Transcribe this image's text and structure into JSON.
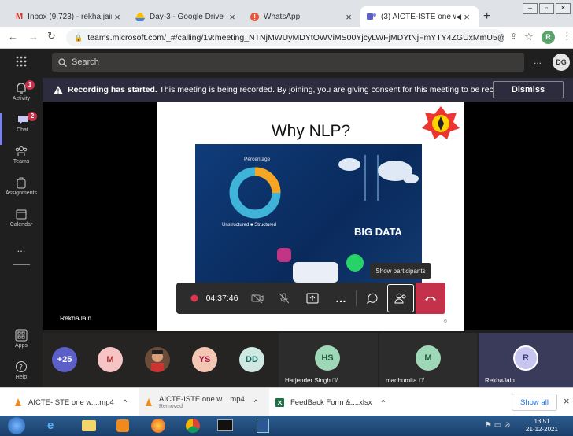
{
  "tabs": [
    {
      "title": "Inbox (9,723) - rekha.jain@",
      "icon": "gmail-icon"
    },
    {
      "title": "Day-3 - Google Drive",
      "icon": "drive-icon"
    },
    {
      "title": "WhatsApp",
      "icon": "whatsapp-icon"
    },
    {
      "title": "(3) AICTE-ISTE one wee",
      "icon": "teams-icon",
      "active": true
    }
  ],
  "new_tab": "+",
  "address": {
    "url": "teams.microsoft.com/_#/calling/19:meeting_NTNjMWUyMDYtOWViMS00YjcyLWFjMDYtNjFmYTY4ZGUxMmU5@threa...",
    "profile": "R"
  },
  "teams": {
    "search_placeholder": "Search",
    "more": "...",
    "user_initials": "DG"
  },
  "rail": [
    {
      "label": "Activity",
      "badge": "1"
    },
    {
      "label": "Chat",
      "badge": "2"
    },
    {
      "label": "Teams"
    },
    {
      "label": "Assignments"
    },
    {
      "label": "Calendar"
    },
    {
      "label": "..."
    }
  ],
  "rail_bottom": [
    {
      "label": "Apps"
    },
    {
      "label": "Help"
    }
  ],
  "banner": {
    "bold": "Recording has started.",
    "text": "This meeting is being recorded. By joining, you are giving consent for this meeting to be recor...",
    "dismiss": "Dismiss"
  },
  "slide": {
    "title": "Why NLP?",
    "percentage": "Percentage",
    "legend": "Unstructured ■ Structured",
    "big_data": "BIG DATA",
    "page": "6"
  },
  "presenter": "RekhaJain",
  "controls": {
    "timer": "04:37:46",
    "tooltip": "Show participants"
  },
  "participants": [
    {
      "initials": "+25",
      "color": "#5b5fc7"
    },
    {
      "initials": "M",
      "color": "#f6c4c4"
    },
    {
      "initials": "",
      "color": "#6b4b3a"
    },
    {
      "initials": "YS",
      "color": "#f4c7b4"
    },
    {
      "initials": "DD",
      "color": "#cfe8e2"
    }
  ],
  "tiles": [
    {
      "initials": "HS",
      "name": "Harjender Singh",
      "color": "#9fd8b8"
    },
    {
      "initials": "M",
      "name": "madhumita",
      "color": "#9fd8b8"
    },
    {
      "initials": "R",
      "name": "RekhaJain",
      "color": "#c8c6f0"
    }
  ],
  "downloads": [
    {
      "name": "AICTE-ISTE one w....mp4",
      "sub": ""
    },
    {
      "name": "AICTE-ISTE one w....mp4",
      "sub": "Removed"
    },
    {
      "name": "FeedBack Form &....xlsx",
      "sub": ""
    }
  ],
  "show_all": "Show all",
  "clock": {
    "time": "13:51",
    "date": "21-12-2021"
  }
}
